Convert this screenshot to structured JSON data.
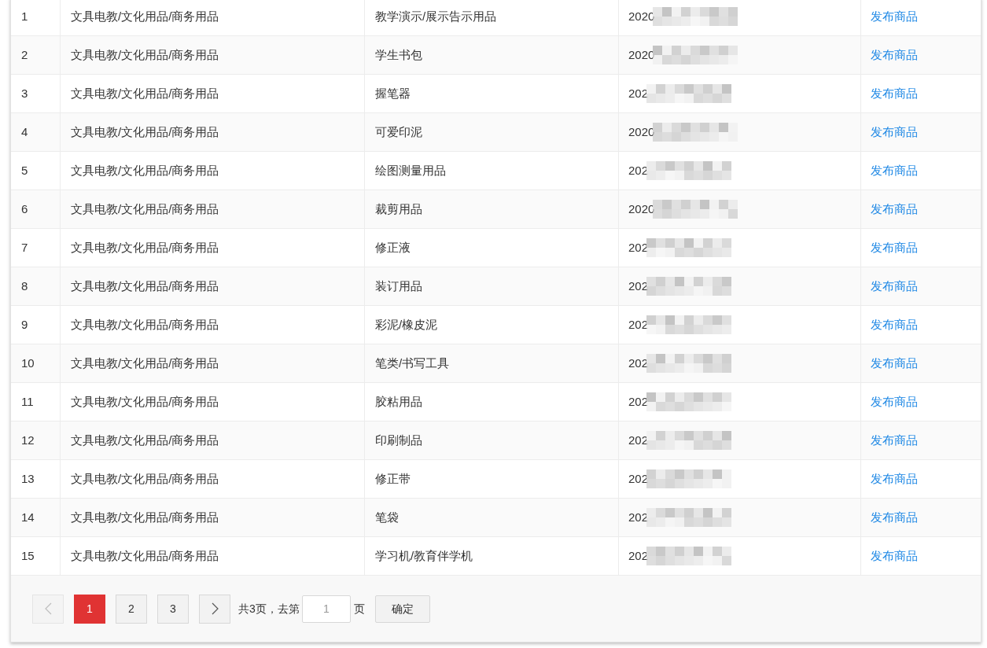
{
  "table": {
    "rows": [
      {
        "index": "1",
        "category": "文具电教/文化用品/商务用品",
        "subcategory": "教学演示/展示告示用品",
        "date": "2020",
        "action": "发布商品"
      },
      {
        "index": "2",
        "category": "文具电教/文化用品/商务用品",
        "subcategory": "学生书包",
        "date": "2020",
        "action": "发布商品"
      },
      {
        "index": "3",
        "category": "文具电教/文化用品/商务用品",
        "subcategory": "握笔器",
        "date": "202",
        "action": "发布商品"
      },
      {
        "index": "4",
        "category": "文具电教/文化用品/商务用品",
        "subcategory": "可爱印泥",
        "date": "2020",
        "action": "发布商品"
      },
      {
        "index": "5",
        "category": "文具电教/文化用品/商务用品",
        "subcategory": "绘图测量用品",
        "date": "202",
        "action": "发布商品"
      },
      {
        "index": "6",
        "category": "文具电教/文化用品/商务用品",
        "subcategory": "裁剪用品",
        "date": "2020",
        "action": "发布商品"
      },
      {
        "index": "7",
        "category": "文具电教/文化用品/商务用品",
        "subcategory": "修正液",
        "date": "202",
        "action": "发布商品"
      },
      {
        "index": "8",
        "category": "文具电教/文化用品/商务用品",
        "subcategory": "装订用品",
        "date": "202",
        "action": "发布商品"
      },
      {
        "index": "9",
        "category": "文具电教/文化用品/商务用品",
        "subcategory": "彩泥/橡皮泥",
        "date": "202",
        "action": "发布商品"
      },
      {
        "index": "10",
        "category": "文具电教/文化用品/商务用品",
        "subcategory": "笔类/书写工具",
        "date": "202",
        "action": "发布商品"
      },
      {
        "index": "11",
        "category": "文具电教/文化用品/商务用品",
        "subcategory": "胶粘用品",
        "date": "202",
        "action": "发布商品"
      },
      {
        "index": "12",
        "category": "文具电教/文化用品/商务用品",
        "subcategory": "印刷制品",
        "date": "202",
        "action": "发布商品"
      },
      {
        "index": "13",
        "category": "文具电教/文化用品/商务用品",
        "subcategory": "修正带",
        "date": "202",
        "action": "发布商品"
      },
      {
        "index": "14",
        "category": "文具电教/文化用品/商务用品",
        "subcategory": "笔袋",
        "date": "202",
        "action": "发布商品"
      },
      {
        "index": "15",
        "category": "文具电教/文化用品/商务用品",
        "subcategory": "学习机/教育伴学机",
        "date": "202",
        "action": "发布商品"
      }
    ]
  },
  "pagination": {
    "prev": {
      "disabled": true
    },
    "next": {
      "disabled": false
    },
    "pages": [
      {
        "label": "1",
        "selected": true
      },
      {
        "label": "2",
        "selected": false
      },
      {
        "label": "3",
        "selected": false
      }
    ],
    "total_text": "共3页，去第",
    "page_input": "1",
    "page_suffix": "页",
    "confirm": "确定"
  }
}
